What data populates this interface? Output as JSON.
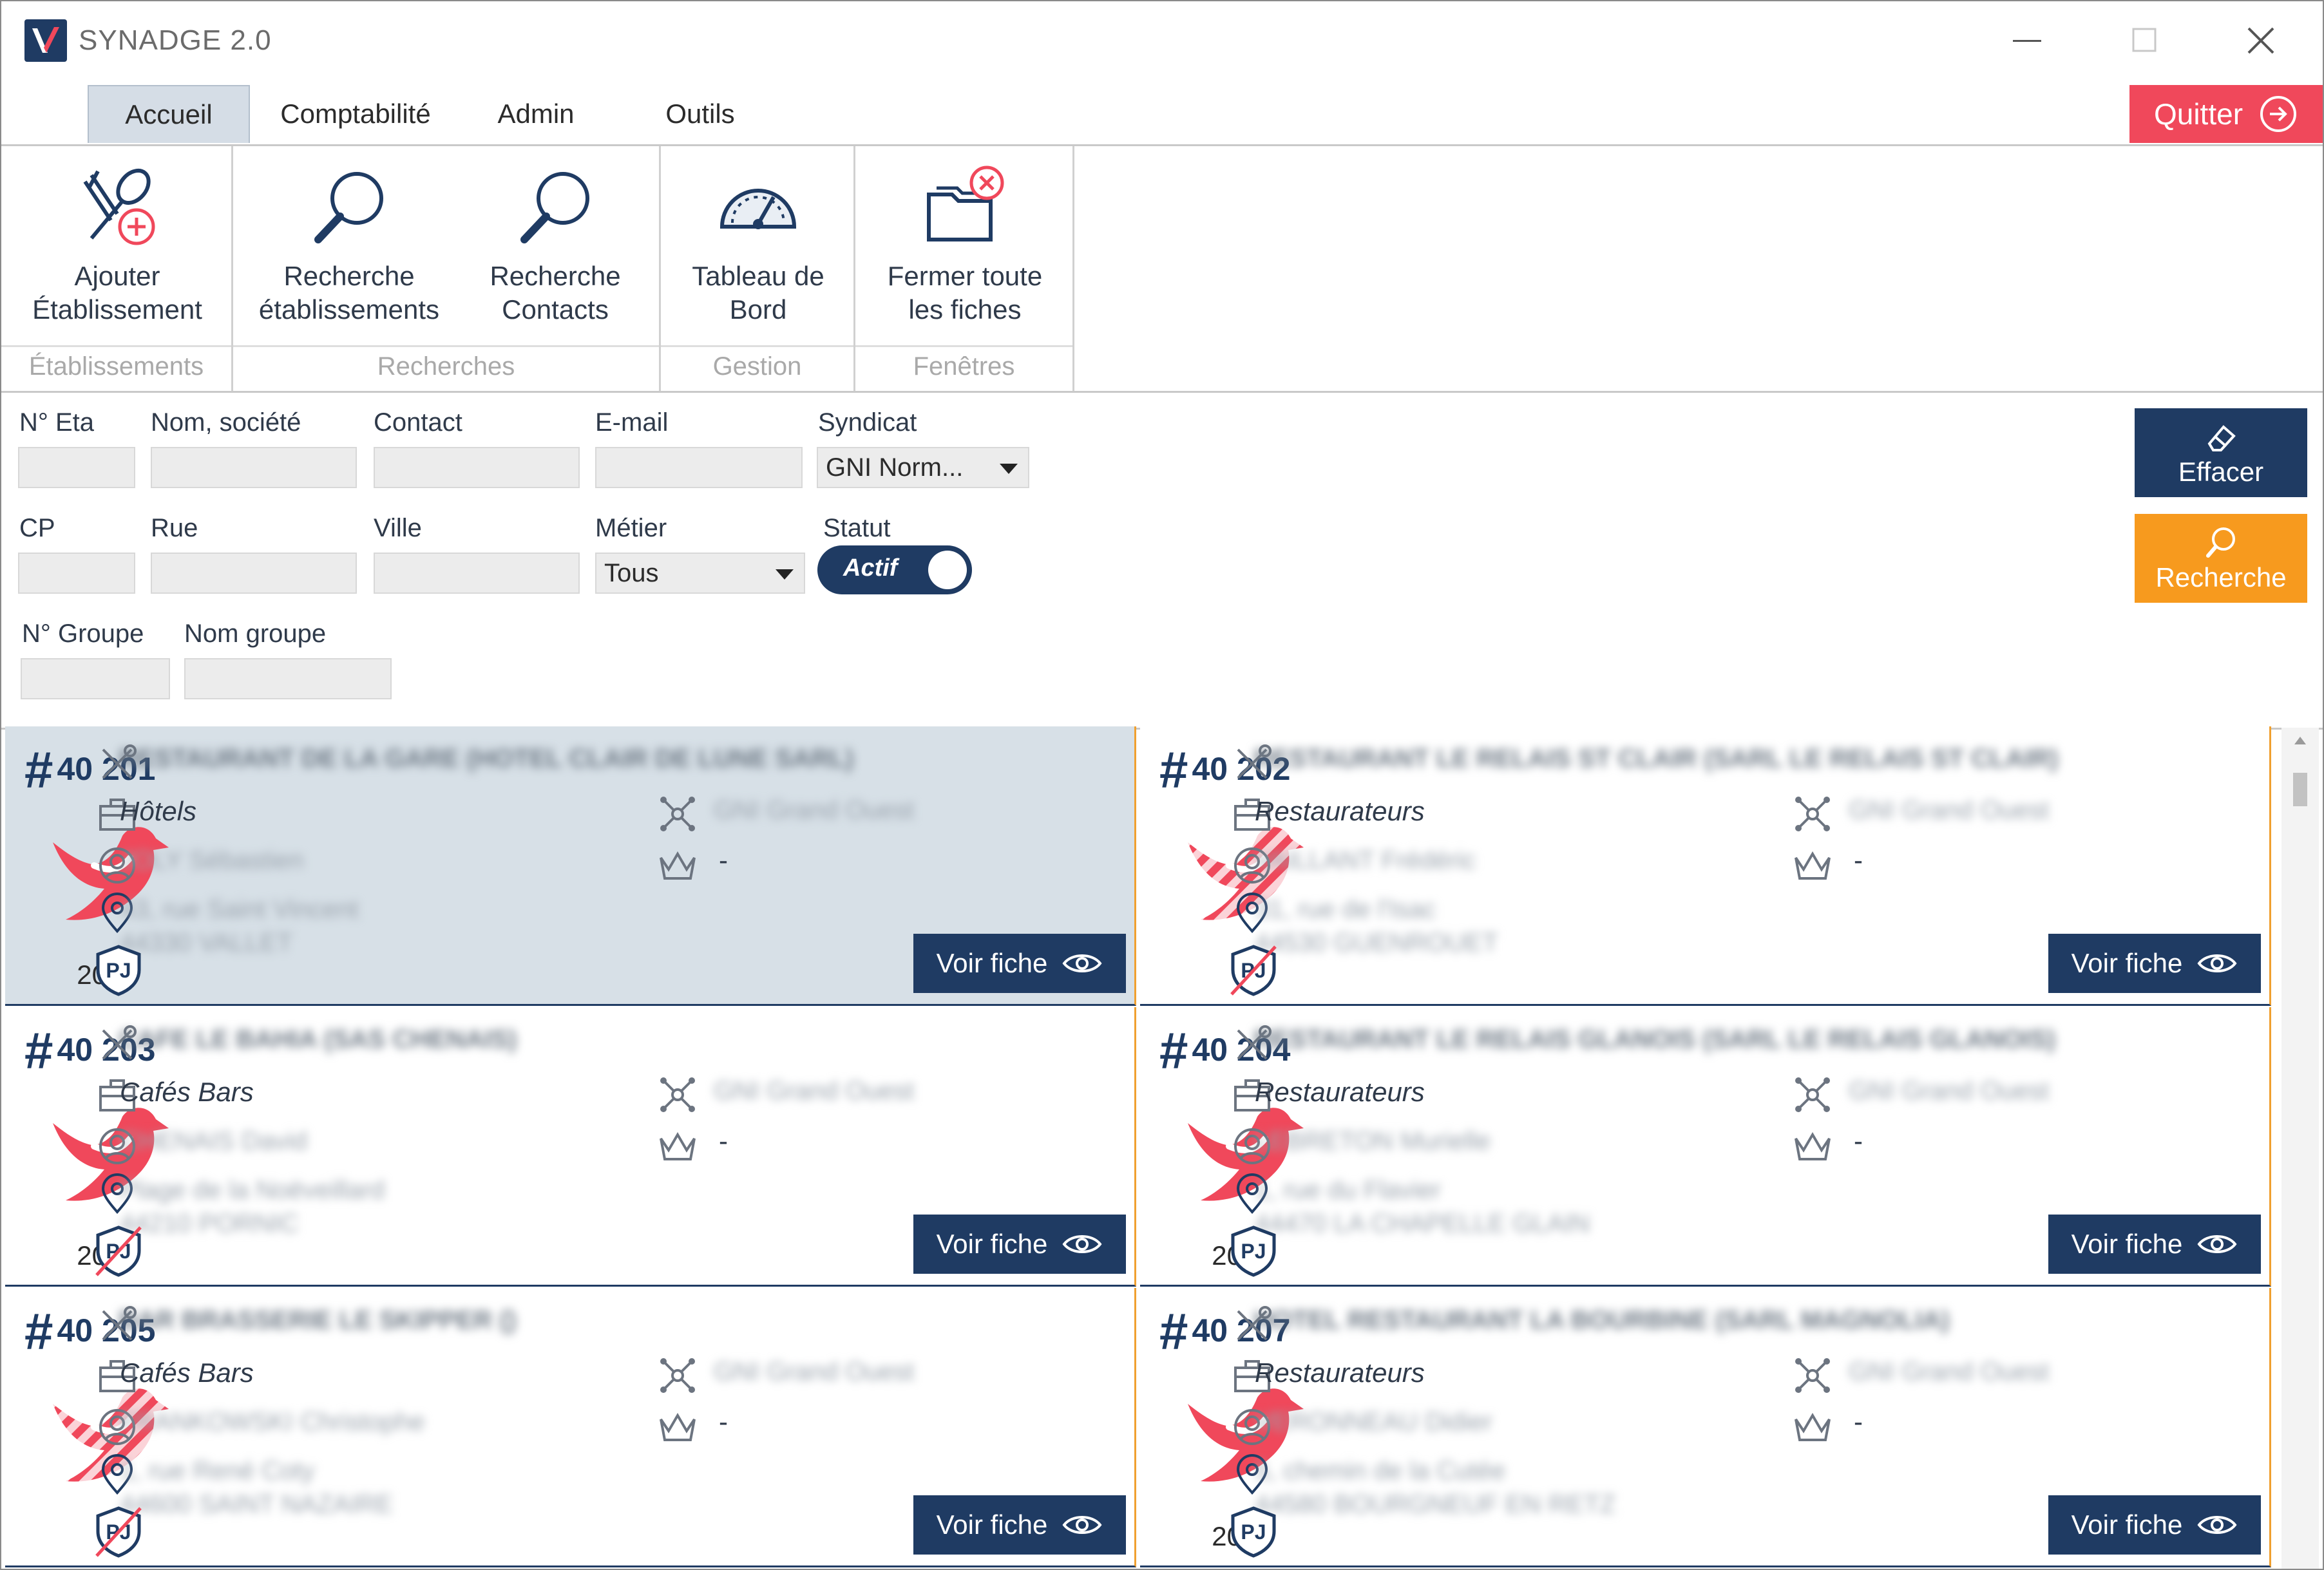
{
  "app": {
    "title": "SYNADGE 2.0"
  },
  "menu": {
    "tabs": [
      "Accueil",
      "Comptabilité",
      "Admin",
      "Outils"
    ],
    "quit": "Quitter"
  },
  "ribbon": {
    "groups": [
      "Établissements",
      "Recherches",
      "Gestion",
      "Fenêtres"
    ],
    "buttons": {
      "ajouter": [
        "Ajouter",
        "Établissement"
      ],
      "recherche_eta": [
        "Recherche",
        "établissements"
      ],
      "recherche_contacts": [
        "Recherche",
        "Contacts"
      ],
      "tableau": [
        "Tableau de",
        "Bord"
      ],
      "fermer": [
        "Fermer toute",
        "les fiches"
      ]
    }
  },
  "form": {
    "labels": {
      "num_eta": "N° Eta",
      "nom": "Nom, société",
      "contact": "Contact",
      "email": "E-mail",
      "syndicat": "Syndicat",
      "cp": "CP",
      "rue": "Rue",
      "ville": "Ville",
      "metier": "Métier",
      "statut": "Statut",
      "num_groupe": "N° Groupe",
      "nom_groupe": "Nom groupe"
    },
    "values": {
      "num_eta": "",
      "nom": "",
      "contact": "",
      "email": "",
      "cp": "",
      "rue": "",
      "ville": "",
      "num_groupe": "",
      "nom_groupe": ""
    },
    "syndicat_selected": "GNI Norm...",
    "metier_selected": "Tous",
    "statut_toggle": "Actif",
    "effacer": "Effacer",
    "recherche": "Recherche"
  },
  "cards": [
    {
      "number": "40 201",
      "year": "2022",
      "category": "Hôtels",
      "crown": "-",
      "bird": "solid",
      "pj_crossed": false,
      "selected": true,
      "name": "RESTAURANT DE LA GARE (HOTEL CLAIR DE LUNE SARL)",
      "syndicat": "GNI Grand Ouest",
      "contact": "JOLY Sébastien",
      "address1": "43, rue Saint Vincent",
      "address2": "44330 VALLET",
      "button": "Voir fiche"
    },
    {
      "number": "40 202",
      "year": "",
      "category": "Restaurateurs",
      "crown": "-",
      "bird": "striped",
      "pj_crossed": true,
      "selected": false,
      "name": "RESTAURANT LE RELAIS ST CLAIR (SARL LE RELAIS ST CLAIR)",
      "syndicat": "GNI Grand Ouest",
      "contact": "VAILLANT Frédéric",
      "address1": "31, rue de l'Isac",
      "address2": "44530 GUENROUET",
      "button": "Voir fiche"
    },
    {
      "number": "40 203",
      "year": "2022",
      "category": "Cafés Bars",
      "crown": "-",
      "bird": "solid",
      "pj_crossed": true,
      "selected": false,
      "name": "CAFE LE BAHIA (SAS CHENAIS)",
      "syndicat": "GNI Grand Ouest",
      "contact": "CHENAIS David",
      "address1": "Plage de la Noëveillard",
      "address2": "44210 PORNIC",
      "button": "Voir fiche"
    },
    {
      "number": "40 204",
      "year": "2022",
      "category": "Restaurateurs",
      "crown": "-",
      "bird": "solid",
      "pj_crossed": false,
      "selected": false,
      "name": "RESTAURANT LE RELAIS GLANOIS (SARL LE RELAIS GLANOIS)",
      "syndicat": "GNI Grand Ouest",
      "contact": "LEBRETON Murielle",
      "address1": "1, rue du Flavier",
      "address2": "44470 LA CHAPELLE GLAIN",
      "button": "Voir fiche"
    },
    {
      "number": "40 205",
      "year": "",
      "category": "Cafés Bars",
      "crown": "-",
      "bird": "striped",
      "pj_crossed": true,
      "selected": false,
      "name": "BAR BRASSERIE LE SKIPPER ()",
      "syndicat": "GNI Grand Ouest",
      "contact": "FRANKOWSKI Christophe",
      "address1": "1, rue René Coty",
      "address2": "44600 SAINT NAZAIRE",
      "button": "Voir fiche"
    },
    {
      "number": "40 207",
      "year": "2022",
      "category": "Restaurateurs",
      "crown": "-",
      "bird": "solid",
      "pj_crossed": false,
      "selected": false,
      "name": "HOTEL RESTAURANT LA BOURBINE (SARL MAGNOLIA)",
      "syndicat": "GNI Grand Ouest",
      "contact": "VERONNEAU Didier",
      "address1": "5, chemin de la Cutée",
      "address2": "44580 BOURGNEUF EN RETZ",
      "button": "Voir fiche"
    }
  ]
}
